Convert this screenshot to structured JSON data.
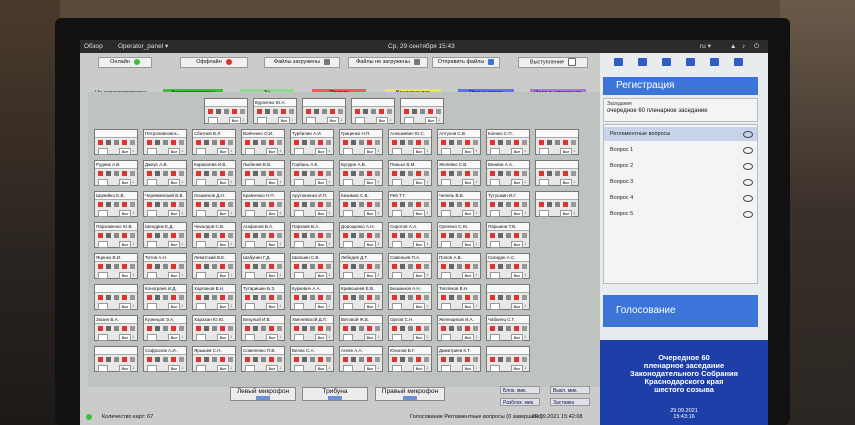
{
  "topbar": {
    "overview": "Обзор",
    "app": "Operator_panel ▾",
    "clock": "Ср, 29 сентября  15:43",
    "lang": "ru ▾"
  },
  "status": {
    "online": "Онлайн",
    "offline": "Оффлайн",
    "files_loaded": "Файлы загружены",
    "files_not_loaded": "Файлы не загружены",
    "send_files": "Отправить файлы",
    "speech": "Выступление"
  },
  "legend": [
    {
      "label": "Не зарегистрирован",
      "color": "#f4f4f4"
    },
    {
      "label": "Зарегистрирован",
      "color": "#3bbf3b"
    },
    {
      "label": "За",
      "color": "#8fd88f"
    },
    {
      "label": "Против",
      "color": "#ef5a5a"
    },
    {
      "label": "Воздержался",
      "color": "#e3ea6a"
    },
    {
      "label": "Прошу слова",
      "color": "#5f72e6"
    },
    {
      "label": "Идет выступление",
      "color": "#a676d9"
    }
  ],
  "seat_btn": "Вкл",
  "rows": [
    [
      "",
      "Вурлачко Ю.А.",
      "",
      "",
      ""
    ],
    [
      "",
      "Петропавловск...",
      "Сбитнев В.Л.",
      "Войченко О.И.",
      "Турбилин А.И.",
      "Гриценко Н.П.",
      "Алешкевич Ю.С.",
      "Алтухов С.В.",
      "Коенко С.П.",
      ""
    ],
    [
      "Рудник А.В.",
      "Джиус А.В.",
      "Караалева И.В.",
      "Лыбенев В.В.",
      "Горбань А.Е.",
      "Булдин А.В.",
      "Панько В.М.",
      "Желевко С.В.",
      "Ванина А.А.",
      ""
    ],
    [
      "Шумейко Е.В.",
      "Черевкевский В.В.",
      "Лошкенов Д.Н.",
      "Кравченко Н.П.",
      "Арутюненко И.П.",
      "Кизимов С.В.",
      "Рей Т.Г.",
      "Чепель В.В.",
      "Тутушкин И.Г.",
      ""
    ],
    [
      "Пархоменко Ю.В.",
      "Шендрик Е.Д.",
      "Чекалдов С.В.",
      "Агафонов В.А.",
      "Пархаев В.А.",
      "Дорощенко А.Н.",
      "Сиротов А.А.",
      "Орленко С.Ю.",
      "Паршина Т.В."
    ],
    [
      "Яценко В.И.",
      "Титов А.Н.",
      "Левитский В.Е.",
      "Шабунин Г.Д.",
      "Шапшин С.В.",
      "Лебедев Д.Т.",
      "Савельев П.А.",
      "Попов А.В.",
      "Сигидин А.С."
    ],
    [
      "",
      "Конограев И.Д.",
      "Харланов В.Н.",
      "Тутаришин Б.З.",
      "Куркевич А.А.",
      "Кривошеев Е.В.",
      "Бешкинов А.Н.",
      "Тепляков В.Н.",
      ""
    ],
    [
      "Зюзин В.А.",
      "Кузнецов Э.А.",
      "Харахан Ю.Ю.",
      "Безулый И.В.",
      "Хмелевской Д.Л.",
      "Витовой Ж.Б.",
      "Орлов С.Н.",
      "Желещиков И.А.",
      "Чабанец С.Г."
    ],
    [
      "",
      "Сафронов А.И.",
      "Ярышев С.Н.",
      "Совеленко П.В.",
      "Велах С.А.",
      "Агеев А.А.",
      "Юнзнов В.Г.",
      "Димитриев К.Т.",
      ""
    ]
  ],
  "mics": {
    "left": "Левый микрофон",
    "tribune": "Трибуна",
    "right": "Правый микрофон"
  },
  "side_buttons": {
    "block_mic": "Блок. мик.",
    "unblock_mic": "Разблок. мик.",
    "mic_off": "Выкл. мик.",
    "screensaver": "Заставка"
  },
  "bottombar": {
    "cards": "Количество карт: 67",
    "voting": "Голосование Регламентные вопросы (0 завершено)",
    "stamp": "29.09.2021 15:42:08"
  },
  "right": {
    "registration": "Регистрация",
    "meeting_label": "Заседание",
    "meeting": "очередное 60 пленарное заседание",
    "items": [
      "Регламентные вопросы",
      "Вопрос 1",
      "Вопрос 2",
      "Вопрос 3",
      "Вопрос 4",
      "Вопрос 5"
    ],
    "voting": "Голосование",
    "agenda": [
      "Очередное 60",
      "пленарное заседание",
      "Законодательного Собрания",
      "Краснодарского края",
      "шестого созыва"
    ],
    "date": "29.09.2021",
    "time": "15:43:16"
  }
}
